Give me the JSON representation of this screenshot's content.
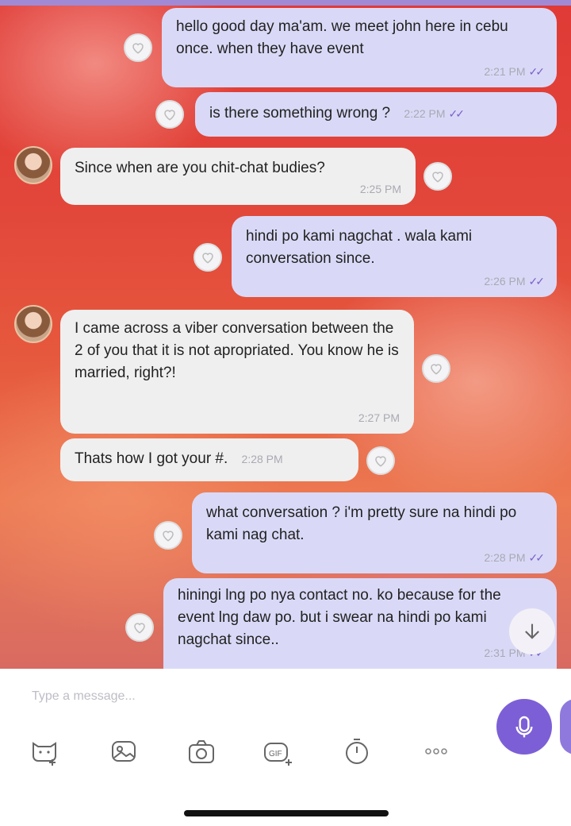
{
  "messages": [
    {
      "id": "m1",
      "dir": "out",
      "text": "hello good day ma'am. we meet john here in cebu once. when they have event",
      "time": "2:21 PM",
      "read": true
    },
    {
      "id": "m2",
      "dir": "out",
      "text": "is there something wrong ?",
      "time": "2:22 PM",
      "read": true
    },
    {
      "id": "m3",
      "dir": "in",
      "text": "Since when are you chit-chat budies?",
      "time": "2:25 PM"
    },
    {
      "id": "m4",
      "dir": "out",
      "text": "hindi po kami nagchat . wala kami conversation since.",
      "time": "2:26 PM",
      "read": true
    },
    {
      "id": "m5",
      "dir": "in",
      "text": "I came across a viber conversation between the 2 of you that it is not apropriated. You know he is married, right?!",
      "time": "2:27 PM"
    },
    {
      "id": "m6",
      "dir": "in",
      "text": "Thats how I got your #.",
      "time": "2:28 PM"
    },
    {
      "id": "m7",
      "dir": "out",
      "text": "what conversation ? i'm pretty sure na hindi po kami nag chat.",
      "time": "2:28 PM",
      "read": true
    },
    {
      "id": "m8",
      "dir": "out",
      "text": "hiningi lng po nya contact no. ko because for the event lng daw po. but i swear na hindi po kami nagchat since..",
      "time": "2:31 PM",
      "read": true
    }
  ],
  "composer": {
    "placeholder": "Type a message...",
    "tools": [
      "sticker-icon",
      "image-icon",
      "camera-icon",
      "gif-icon",
      "timer-icon",
      "more-icon"
    ],
    "gif_label": "GIF"
  },
  "colors": {
    "accent": "#7c5fd6",
    "outgoing_bubble": "#d9d9f7",
    "incoming_bubble": "#efefef"
  }
}
